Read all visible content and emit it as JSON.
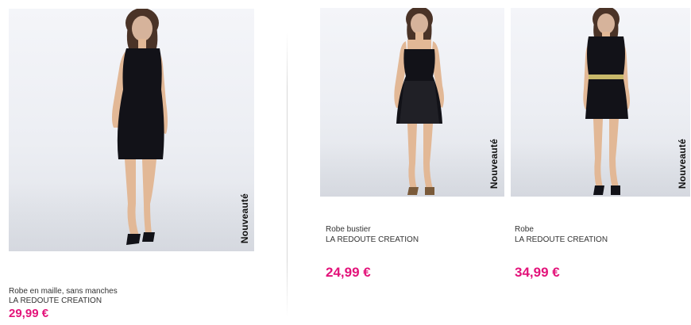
{
  "products": [
    {
      "name": "Robe en maille, sans manches",
      "brand": "LA REDOUTE CREATION",
      "price": "29,99 €",
      "badge": "Nouveauté",
      "image": "woman-in-black-sleeveless-knit-dress"
    },
    {
      "name": "Robe bustier",
      "brand": "LA REDOUTE CREATION",
      "price": "24,99 €",
      "badge": "Nouveauté",
      "image": "woman-in-black-strapless-lace-dress"
    },
    {
      "name": "Robe",
      "brand": "LA REDOUTE CREATION",
      "price": "34,99 €",
      "badge": "Nouveauté",
      "image": "woman-in-black-dress-with-gold-belt"
    }
  ],
  "colors": {
    "price": "#e3137a",
    "badge_text": "#111111",
    "photo_background": "#eceef3",
    "dress": "#121218",
    "skin": "#e2b896",
    "hair": "#4a3327"
  }
}
